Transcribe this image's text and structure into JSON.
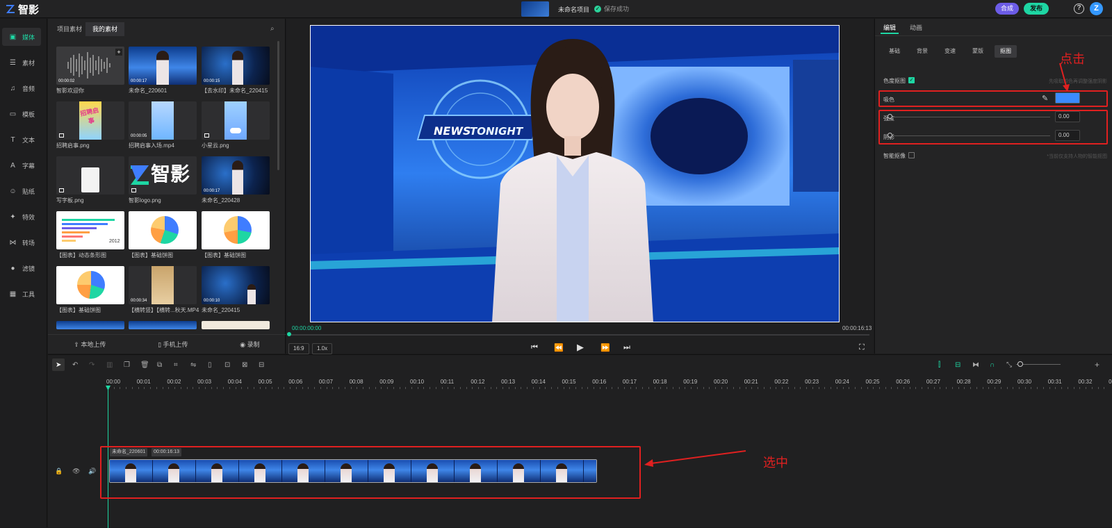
{
  "app": {
    "name": "智影",
    "project_title": "未命名项目",
    "save_status": "保存成功"
  },
  "header": {
    "compose_label": "合成",
    "publish_label": "发布",
    "help_label": "?",
    "avatar_label": "Z"
  },
  "nav": [
    {
      "label": "媒体",
      "icon": "media-icon"
    },
    {
      "label": "素材",
      "icon": "layers-icon"
    },
    {
      "label": "音频",
      "icon": "music-icon"
    },
    {
      "label": "模板",
      "icon": "template-icon"
    },
    {
      "label": "文本",
      "icon": "text-icon"
    },
    {
      "label": "字幕",
      "icon": "subtitle-icon"
    },
    {
      "label": "贴纸",
      "icon": "sticker-icon"
    },
    {
      "label": "特效",
      "icon": "effects-icon"
    },
    {
      "label": "转场",
      "icon": "transition-icon"
    },
    {
      "label": "滤镜",
      "icon": "filter-icon"
    },
    {
      "label": "工具",
      "icon": "tools-icon"
    }
  ],
  "assets": {
    "tabs": [
      "项目素材",
      "我的素材"
    ],
    "items": [
      {
        "label": "智影欢迎你",
        "duration": "00:00:02"
      },
      {
        "label": "未命名_220601",
        "duration": "00:00:17"
      },
      {
        "label": "【去水印】未命名_220415",
        "duration": "00:00:15"
      },
      {
        "label": "招聘启事.png",
        "duration": ""
      },
      {
        "label": "招聘启事入场.mp4",
        "duration": "00:00:05"
      },
      {
        "label": "小星云.png",
        "duration": ""
      },
      {
        "label": "写字板.png",
        "duration": ""
      },
      {
        "label": "智影logo.png",
        "duration": ""
      },
      {
        "label": "未命名_220428",
        "duration": "00:00:17"
      },
      {
        "label": "【图表】动态条形图",
        "duration": ""
      },
      {
        "label": "【图表】基础饼图",
        "duration": ""
      },
      {
        "label": "【图表】基础饼图",
        "duration": ""
      },
      {
        "label": "【图表】基础饼图",
        "duration": ""
      },
      {
        "label": "【横转竖】【横转...秋天.MP4",
        "duration": "00:00:34"
      },
      {
        "label": "未命名_220415",
        "duration": "00:00:10"
      }
    ],
    "logo_text": "智影",
    "bar_year": "2012",
    "poster_text": "招聘启事",
    "upload": {
      "local": "本地上传",
      "phone": "手机上传",
      "record": "录制"
    }
  },
  "preview": {
    "current_time": "00:00:00:00",
    "total_time": "00:00:16:13",
    "ratio": "16:9",
    "speed": "1.0x",
    "news_word1": "NEWS",
    "news_word2": "TONIGHT"
  },
  "props": {
    "tabs": [
      "编辑",
      "动画"
    ],
    "subtabs": [
      "基础",
      "背景",
      "变速",
      "蒙版",
      "抠图"
    ],
    "chroma_label": "色度抠图",
    "chroma_hint": "先吸取颜色再调整强度阴影",
    "pick_label": "吸色",
    "pick_color": "#3b8bff",
    "strength_label": "强度",
    "strength_value": "0.00",
    "shadow_label": "阴影",
    "shadow_value": "0.00",
    "smart_label": "智能抠像",
    "smart_hint": "*当前仅支持人物的智能抠图",
    "annotation_click": "点击"
  },
  "timeline": {
    "ruler": [
      "00:00",
      "00:01",
      "00:02",
      "00:03",
      "00:04",
      "00:05",
      "00:06",
      "00:07",
      "00:08",
      "00:09",
      "00:10",
      "00:11",
      "00:12",
      "00:13",
      "00:14",
      "00:15",
      "00:16",
      "00:17",
      "00:18",
      "00:19",
      "00:20",
      "00:21",
      "00:22",
      "00:23",
      "00:24",
      "00:25",
      "00:26",
      "00:27",
      "00:28",
      "00:29",
      "00:30",
      "00:31",
      "00:32",
      "00"
    ],
    "clip_name": "未命名_220601",
    "clip_duration": "00:00:16:13",
    "annotation_selected": "选中"
  }
}
